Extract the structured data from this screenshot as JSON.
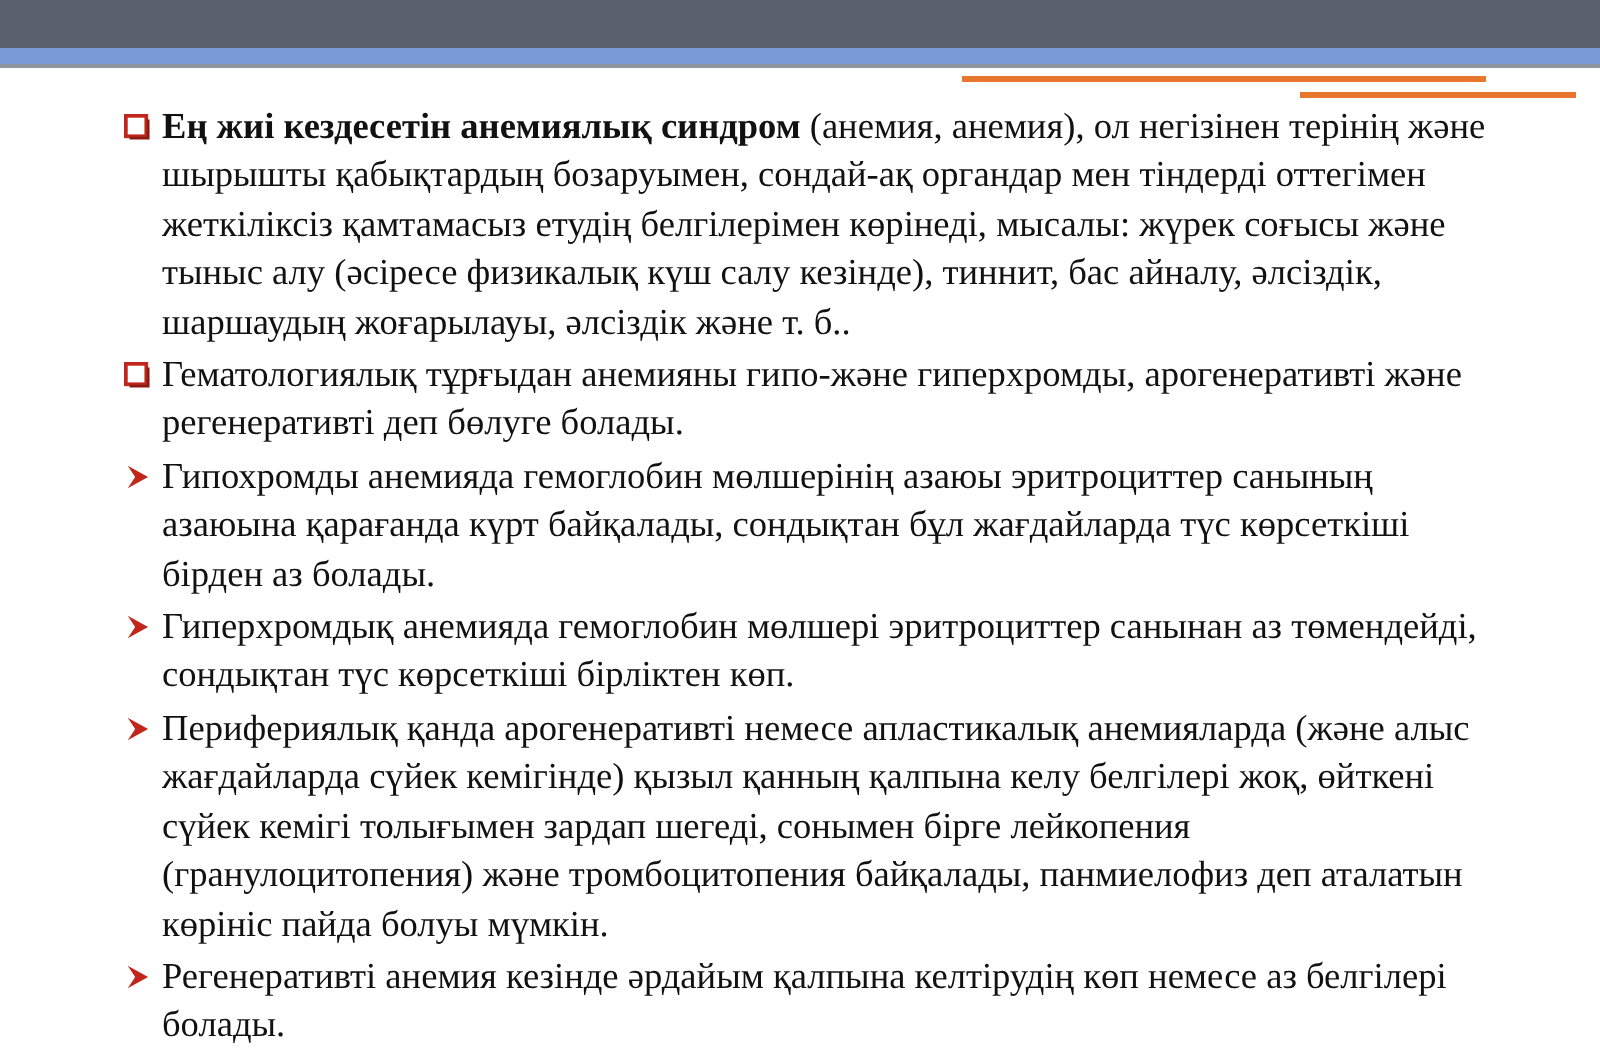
{
  "items": [
    {
      "kind": "square",
      "text": "**Ең жиі кездесетін анемиялық синдром** (анемия, анемия), ол негізінен терінің және шырышты қабықтардың бозаруымен, сондай-ақ органдар мен тіндерді оттегімен жеткіліксіз қамтамасыз етудің белгілерімен көрінеді, мысалы: жүрек соғысы және тыныс алу (әсіресе физикалық күш салу кезінде), тиннит, бас айналу, әлсіздік, шаршаудың жоғарылауы, әлсіздік және т. б.."
    },
    {
      "kind": "square",
      "text": "Гематологиялық тұрғыдан анемияны гипо-және гиперхромды, арогенеративті және регенеративті деп бөлуге болады."
    },
    {
      "kind": "arrow",
      "text": "Гипохромды анемияда гемоглобин мөлшерінің азаюы эритроциттер санының азаюына қарағанда күрт байқалады, сондықтан бұл жағдайларда түс көрсеткіші бірден аз болады."
    },
    {
      "kind": "arrow",
      "text": "Гиперхромдық анемияда гемоглобин мөлшері эритроциттер санынан аз төмендейді, сондықтан түс көрсеткіші бірліктен көп."
    },
    {
      "kind": "arrow",
      "text": "Перифериялық қанда арогенеративті немесе апластикалық анемияларда (және алыс жағдайларда сүйек кемігінде) қызыл қанның қалпына келу белгілері жоқ, өйткені сүйек кемігі толығымен зардап шегеді, сонымен бірге лейкопения (гранулоцитопения) және тромбоцитопения байқалады, панмиелофиз деп аталатын көрініс пайда болуы мүмкін."
    },
    {
      "kind": "arrow",
      "text": "Регенеративті анемия кезінде әрдайым қалпына келтірудің көп немесе аз белгілері болады."
    }
  ]
}
